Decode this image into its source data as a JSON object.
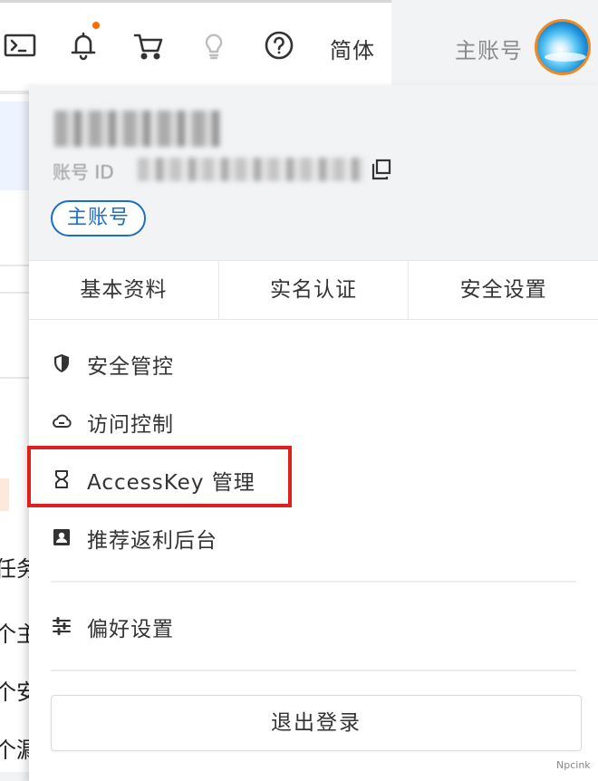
{
  "topbar": {
    "icons": [
      "terminal-icon",
      "bell-icon",
      "cart-icon",
      "lightbulb-icon",
      "help-icon"
    ],
    "has_notification": true,
    "language_label": "简体",
    "account_label": "主账号"
  },
  "background_fragments": [
    "任务",
    "个主",
    "个安",
    "个漏"
  ],
  "dropdown": {
    "profile": {
      "account_name": "",
      "account_id_label": "账号 ID",
      "account_id": "",
      "account_type_badge": "主账号"
    },
    "tabs": [
      {
        "label": "基本资料"
      },
      {
        "label": "实名认证"
      },
      {
        "label": "安全设置"
      }
    ],
    "menu_items": [
      {
        "label": "安全管控",
        "icon": "shield-icon"
      },
      {
        "label": "访问控制",
        "icon": "cloud-icon"
      },
      {
        "label": "AccessKey 管理",
        "icon": "key-icon",
        "highlighted": true
      },
      {
        "label": "推荐返利后台",
        "icon": "referral-icon"
      },
      {
        "label": "偏好设置",
        "icon": "sliders-icon"
      }
    ],
    "logout_label": "退出登录"
  },
  "colors": {
    "accent_blue": "#1a6fc9",
    "highlight_red": "#e02020",
    "notification_orange": "#ff6a00",
    "panel_gray": "#f2f3f5"
  },
  "watermark": "Npcink"
}
